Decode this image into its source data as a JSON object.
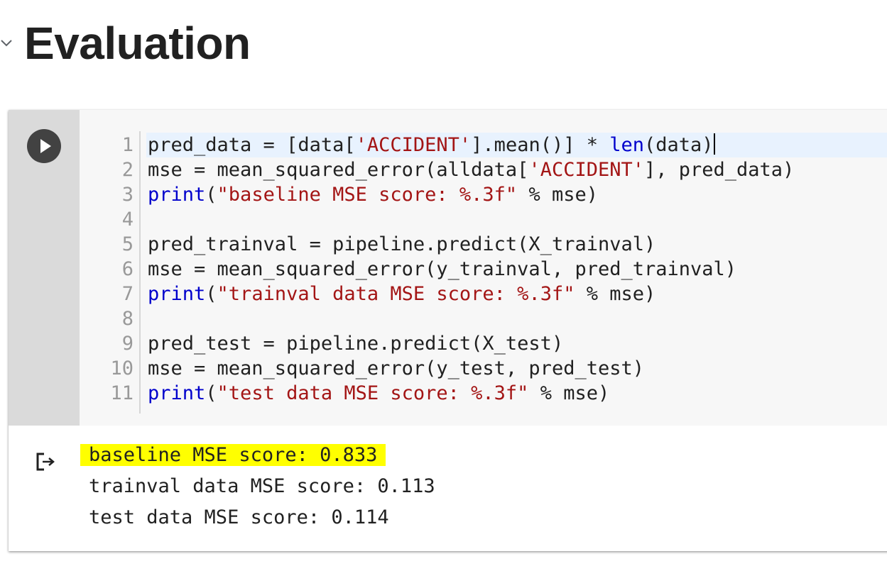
{
  "section": {
    "title": "Evaluation"
  },
  "cell": {
    "icons": {
      "run": "play-icon",
      "collapse": "chevron-down-icon",
      "output": "output-redirect-icon"
    },
    "line_numbers": [
      "1",
      "2",
      "3",
      "4",
      "5",
      "6",
      "7",
      "8",
      "9",
      "10",
      "11"
    ],
    "code_lines": [
      [
        {
          "t": "pred_data = [data[",
          "c": "plain"
        },
        {
          "t": "'ACCIDENT'",
          "c": "str"
        },
        {
          "t": "].mean()] * ",
          "c": "plain"
        },
        {
          "t": "len",
          "c": "builtin"
        },
        {
          "t": "(data)",
          "c": "plain"
        }
      ],
      [
        {
          "t": "mse = mean_squared_error(alldata[",
          "c": "plain"
        },
        {
          "t": "'ACCIDENT'",
          "c": "str"
        },
        {
          "t": "], pred_data)",
          "c": "plain"
        }
      ],
      [
        {
          "t": "print",
          "c": "builtin"
        },
        {
          "t": "(",
          "c": "plain"
        },
        {
          "t": "\"baseline MSE score: %.3f\"",
          "c": "str"
        },
        {
          "t": " % mse)",
          "c": "plain"
        }
      ],
      [],
      [
        {
          "t": "pred_trainval = pipeline.predict(X_trainval)",
          "c": "plain"
        }
      ],
      [
        {
          "t": "mse = mean_squared_error(y_trainval, pred_trainval)",
          "c": "plain"
        }
      ],
      [
        {
          "t": "print",
          "c": "builtin"
        },
        {
          "t": "(",
          "c": "plain"
        },
        {
          "t": "\"trainval data MSE score: %.3f\"",
          "c": "str"
        },
        {
          "t": " % mse)",
          "c": "plain"
        }
      ],
      [],
      [
        {
          "t": "pred_test = pipeline.predict(X_test)",
          "c": "plain"
        }
      ],
      [
        {
          "t": "mse = mean_squared_error(y_test, pred_test)",
          "c": "plain"
        }
      ],
      [
        {
          "t": "print",
          "c": "builtin"
        },
        {
          "t": "(",
          "c": "plain"
        },
        {
          "t": "\"test data MSE score: %.3f\"",
          "c": "str"
        },
        {
          "t": " % mse)",
          "c": "plain"
        }
      ]
    ],
    "output_lines": [
      {
        "text": "baseline MSE score: 0.833",
        "highlighted": true
      },
      {
        "text": "trainval data MSE score: 0.113",
        "highlighted": false
      },
      {
        "text": "test data MSE score: 0.114",
        "highlighted": false
      }
    ]
  },
  "colors": {
    "string": "#a31515",
    "builtin": "#0000cc",
    "highlight": "#ffff00",
    "run_button": "#424242"
  }
}
